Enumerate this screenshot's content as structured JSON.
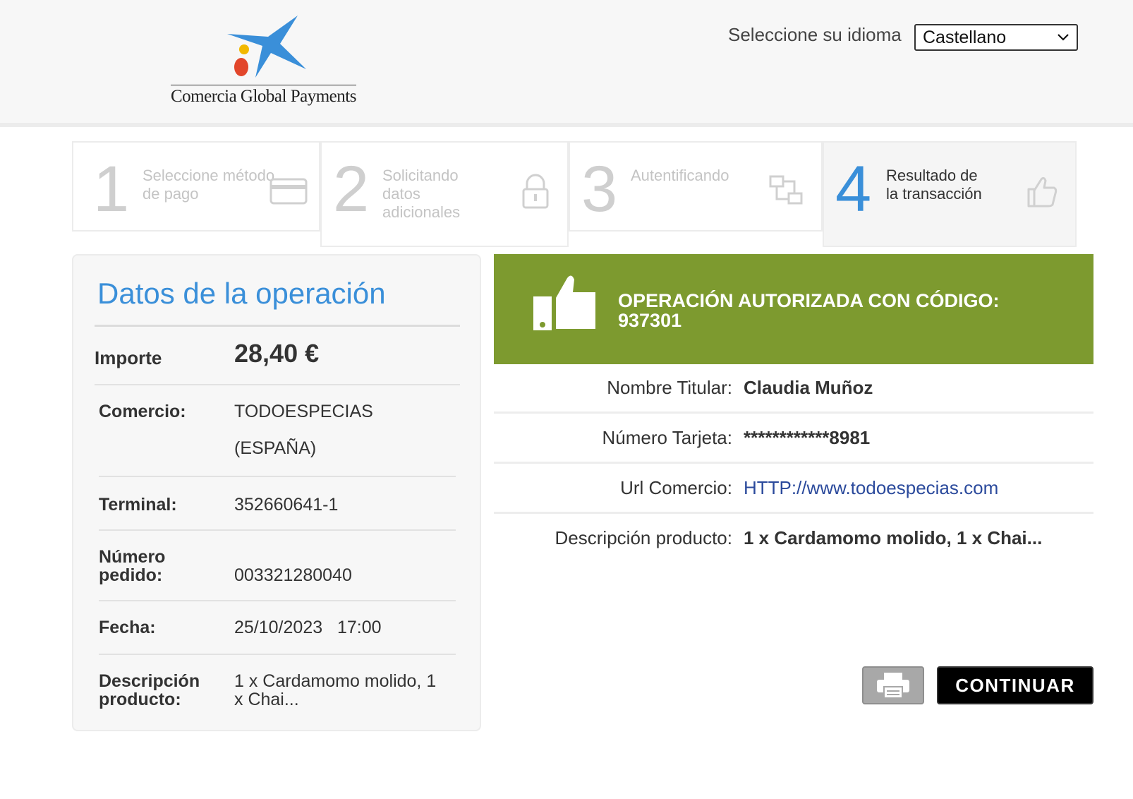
{
  "header": {
    "brand_name": "Comercia Global Payments",
    "language_label": "Seleccione su idioma",
    "language_selected": "Castellano"
  },
  "steps": [
    {
      "number": "1",
      "label": "Seleccione método de pago",
      "icon": "credit-card-icon",
      "state": "done"
    },
    {
      "number": "2",
      "label": "Solicitando datos adicionales",
      "icon": "lock-icon",
      "state": "done"
    },
    {
      "number": "3",
      "label": "Autentificando",
      "icon": "transfer-icon",
      "state": "done"
    },
    {
      "number": "4",
      "label": "Resultado de la transacción",
      "icon": "thumbs-up-icon",
      "state": "active"
    }
  ],
  "operation": {
    "title": "Datos de la operación",
    "importe_label": "Importe",
    "importe_value": "28,40  €",
    "comercio_label": "Comercio:",
    "comercio_value_1": "TODOESPECIAS",
    "comercio_value_2": "(ESPAÑA)",
    "terminal_label": "Terminal:",
    "terminal_value": "352660641-1",
    "pedido_label_1": "Número",
    "pedido_label_2": "pedido:",
    "pedido_value": "003321280040",
    "fecha_label": "Fecha:",
    "fecha_value": "25/10/2023   17:00",
    "descripcion_label_1": "Descripción",
    "descripcion_label_2": "producto:",
    "descripcion_value_1": "1 x Cardamomo molido, 1",
    "descripcion_value_2": "x Chai..."
  },
  "result": {
    "banner_line_1": "OPERACIÓN AUTORIZADA CON CÓDIGO:",
    "banner_line_2": "937301",
    "details": [
      {
        "label": "Nombre Titular:",
        "value": "Claudia Muñoz"
      },
      {
        "label": "Número Tarjeta:",
        "value": "************8981"
      },
      {
        "label": "Url Comercio:",
        "value": "HTTP://www.todoespecias.com"
      },
      {
        "label": "Descripción producto:",
        "value": "1 x Cardamomo molido, 1 x Chai..."
      }
    ]
  },
  "actions": {
    "print_icon": "printer-icon",
    "continue_label": "CONTINUAR"
  },
  "colors": {
    "accent_blue": "#3a8fd9",
    "success_green": "#7d9a2f",
    "link_blue": "#2b4a9c"
  }
}
